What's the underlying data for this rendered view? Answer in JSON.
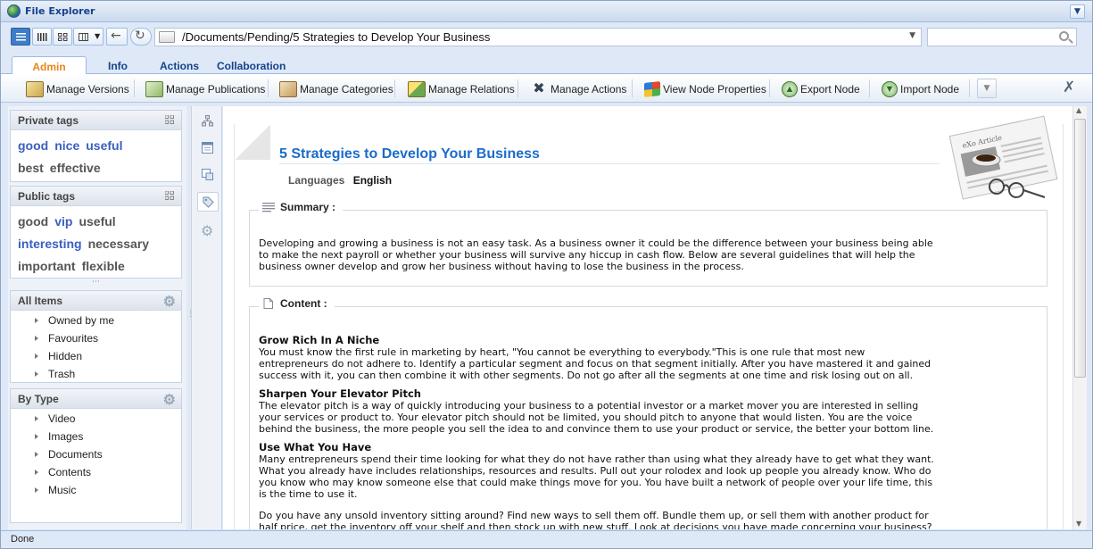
{
  "window": {
    "title": "File Explorer"
  },
  "nav": {
    "path": "/Documents/Pending/5 Strategies to Develop Your Business",
    "search_placeholder": ""
  },
  "tabs": [
    {
      "label": "Admin"
    },
    {
      "label": "Info"
    },
    {
      "label": "Actions"
    },
    {
      "label": "Collaboration"
    }
  ],
  "toolbar": {
    "manage_versions": "Manage Versions",
    "manage_publications": "Manage Publications",
    "manage_categories": "Manage Categories",
    "manage_relations": "Manage Relations",
    "manage_actions": "Manage Actions",
    "view_node_properties": "View Node Properties",
    "export_node": "Export Node",
    "import_node": "Import Node"
  },
  "private_tags": {
    "title": "Private tags",
    "items": [
      "good",
      "nice",
      "useful",
      "best",
      "effective"
    ]
  },
  "public_tags": {
    "title": "Public tags",
    "items": [
      "good",
      "vip",
      "useful",
      "interesting",
      "necessary",
      "important",
      "flexible"
    ]
  },
  "all_items": {
    "title": "All Items",
    "items": [
      "Owned by me",
      "Favourites",
      "Hidden",
      "Trash"
    ]
  },
  "by_type": {
    "title": "By Type",
    "items": [
      "Video",
      "Images",
      "Documents",
      "Contents",
      "Music"
    ]
  },
  "document": {
    "title": "5 Strategies to Develop Your Business",
    "languages_label": "Languages",
    "language": "English",
    "summary_label": "Summary :",
    "summary_lines": [
      "Developing and growing a business is not an easy task. As a business owner it could be the difference between your business being able",
      "to make the next payroll or whether your business will survive any hiccup in cash flow. Below are several guidelines that will help the",
      "business owner develop and grow her business without having to lose the business in the process."
    ],
    "content_label": "Content :",
    "sections": [
      {
        "heading": "Grow Rich In A Niche",
        "lines": [
          "You must know the first rule in marketing by heart, \"You cannot be everything to everybody.\"This is one rule that most new",
          "entrepreneurs do not adhere to. Identify a particular segment and focus on that segment initially. After you have mastered it and gained",
          "success with it, you can then combine it with other segments. Do not go after all the segments at one time and risk losing out on all."
        ]
      },
      {
        "heading": "Sharpen Your Elevator Pitch",
        "lines": [
          "The elevator pitch is a way of quickly introducing your business to a potential investor or a market mover you are interested in selling",
          "your services or product to. Your elevator pitch should not be limited, you should pitch to anyone that would listen. You are the voice",
          "behind the business, the more people you sell the idea to and convince them to use your product or service, the better your bottom line."
        ]
      },
      {
        "heading": "Use What You Have",
        "lines": [
          "Many entrepreneurs spend their time looking for what they do not have rather than using what they already have to get what they want.",
          "What you already have includes relationships, resources and results. Pull out your rolodex and look up people you already know. Who do",
          "you know who may know someone else that could make things move for you. You have built a network of people over your life time, this",
          "is the time to use it."
        ]
      },
      {
        "heading": "",
        "lines": [
          "Do you have any unsold inventory sitting around? Find new ways to sell them off. Bundle them up, or sell them with another product for",
          "half price, get the inventory off your shelf and then stock up with new stuff. Look at decisions you have made concerning your business?"
        ]
      }
    ]
  },
  "status": {
    "text": "Done"
  }
}
